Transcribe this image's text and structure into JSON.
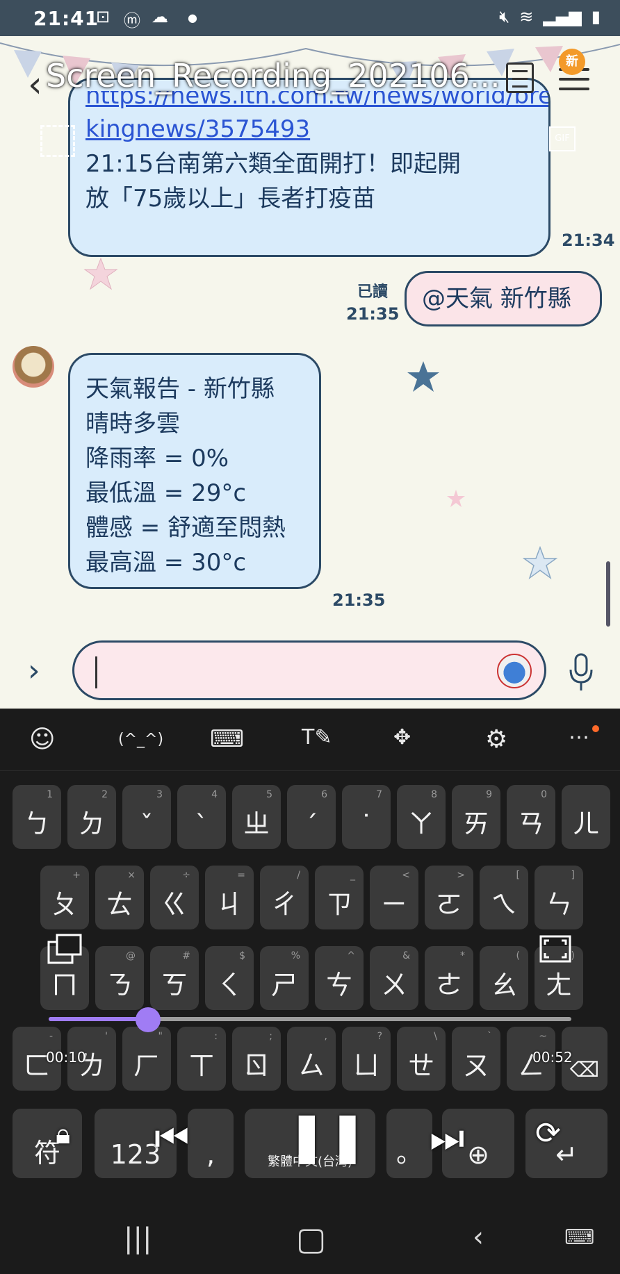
{
  "status_bar": {
    "time": "21:41",
    "left_icons": [
      "screenshot-icon",
      "m-icon",
      "cloud-icon",
      "dot-icon"
    ],
    "right_icons": [
      "mute-icon",
      "wifi-icon",
      "signal-icon",
      "battery-icon"
    ]
  },
  "header": {
    "video_title": "Screen_Recording_202106...",
    "new_badge": "新",
    "gif_label": "GIF"
  },
  "messages": [
    {
      "id": "m1",
      "sender": "other",
      "link_part1": "https://news.ltn.com.tw/news/world/brea",
      "link_part2": "kingnews/3575493",
      "text_line1": "21:15台南第六類全面開打！即起開",
      "text_line2": "放「75歲以上」長者打疫苗",
      "time": "21:34"
    },
    {
      "id": "m2",
      "sender": "self",
      "text": "@天氣 新竹縣",
      "read_label": "已讀",
      "time": "21:35"
    },
    {
      "id": "m3",
      "sender": "other",
      "lines": [
        "天氣報告 - 新竹縣",
        "晴時多雲",
        "降雨率 = 0%",
        "最低溫 = 29°c",
        "體感 = 舒適至悶熱",
        "最高溫 = 30°c"
      ],
      "time": "21:35"
    }
  ],
  "input": {
    "value": "",
    "placeholder": ""
  },
  "keyboard": {
    "toolbar": [
      "emoji-icon",
      "(^_^)",
      "keyboard-icon",
      "text-style-icon",
      "move-icon",
      "settings-icon",
      "more-icon"
    ],
    "kaomoji_label": "(^_^)",
    "row1": [
      [
        "ㄅ",
        "1"
      ],
      [
        "ㄉ",
        "2"
      ],
      [
        "ˇ",
        "3"
      ],
      [
        "ˋ",
        "4"
      ],
      [
        "ㄓ",
        "5"
      ],
      [
        "ˊ",
        "6"
      ],
      [
        "˙",
        "7"
      ],
      [
        "ㄚ",
        "8"
      ],
      [
        "ㄞ",
        "9"
      ],
      [
        "ㄢ",
        "0"
      ],
      [
        "ㄦ",
        ""
      ]
    ],
    "row2": [
      [
        "ㄆ",
        "+"
      ],
      [
        "ㄊ",
        "×"
      ],
      [
        "ㄍ",
        "÷"
      ],
      [
        "ㄐ",
        "="
      ],
      [
        "ㄔ",
        "/"
      ],
      [
        "ㄗ",
        "_"
      ],
      [
        "ㄧ",
        "<"
      ],
      [
        "ㄛ",
        ">"
      ],
      [
        "ㄟ",
        "["
      ],
      [
        "ㄣ",
        "]"
      ]
    ],
    "row3": [
      [
        "ㄇ",
        ""
      ],
      [
        "ㄋ",
        "@"
      ],
      [
        "ㄎ",
        "#"
      ],
      [
        "ㄑ",
        "$"
      ],
      [
        "ㄕ",
        "%"
      ],
      [
        "ㄘ",
        "^"
      ],
      [
        "ㄨ",
        "&"
      ],
      [
        "ㄜ",
        "*"
      ],
      [
        "ㄠ",
        "("
      ],
      [
        "ㄤ",
        ")"
      ]
    ],
    "row4": [
      [
        "ㄈ",
        "-"
      ],
      [
        "ㄌ",
        "'"
      ],
      [
        "ㄏ",
        "\""
      ],
      [
        "ㄒ",
        ":"
      ],
      [
        "ㄖ",
        ";"
      ],
      [
        "ㄙ",
        ","
      ],
      [
        "ㄩ",
        "?"
      ],
      [
        "ㄝ",
        "\\"
      ],
      [
        "ㄡ",
        "`"
      ],
      [
        "ㄥ",
        "~"
      ]
    ],
    "bottom": {
      "symbols": "符",
      "numbers": "123",
      "comma": ",",
      "space": "繁體中文(台灣)",
      "period": "。"
    }
  },
  "media": {
    "elapsed": "00:10",
    "total": "00:52",
    "progress": 0.19
  }
}
